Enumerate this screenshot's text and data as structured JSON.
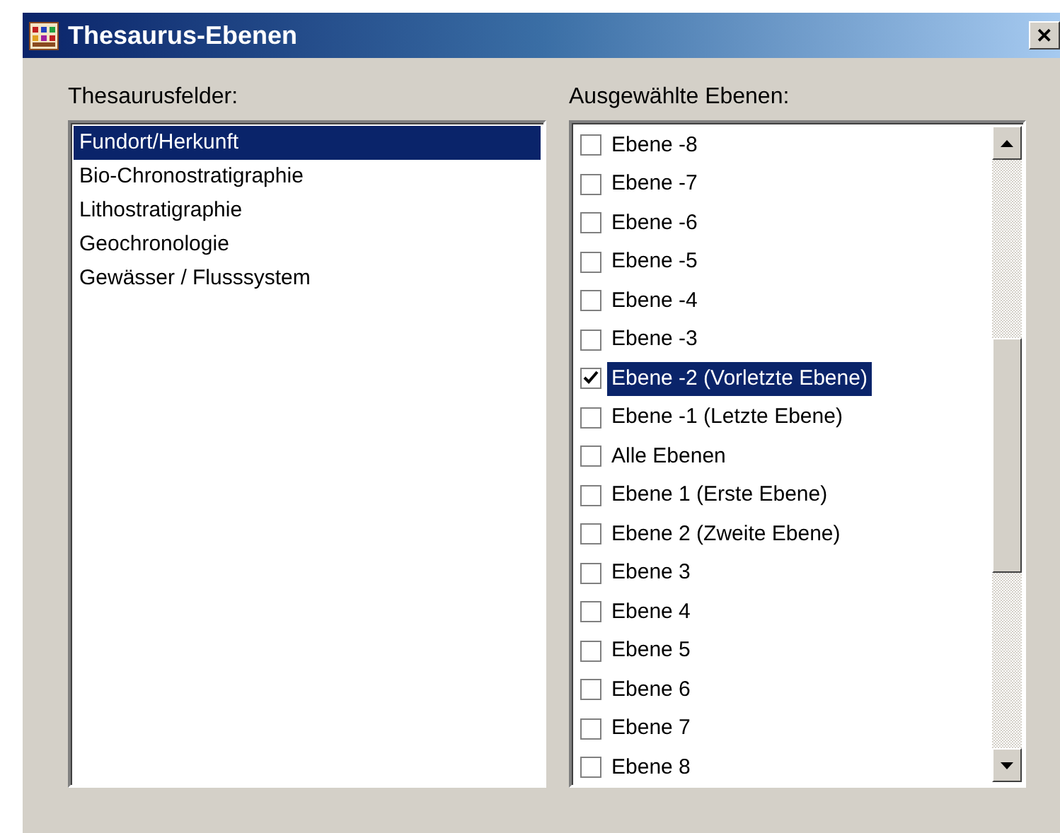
{
  "window": {
    "title": "Thesaurus-Ebenen",
    "close": "✕"
  },
  "left": {
    "label": "Thesaurusfelder:",
    "items": [
      {
        "text": "Fundort/Herkunft",
        "selected": true
      },
      {
        "text": "Bio-Chronostratigraphie",
        "selected": false
      },
      {
        "text": "Lithostratigraphie",
        "selected": false
      },
      {
        "text": "Geochronologie",
        "selected": false
      },
      {
        "text": "Gewässer / Flusssystem",
        "selected": false
      }
    ]
  },
  "right": {
    "label": "Ausgewählte Ebenen:",
    "items": [
      {
        "text": "Ebene -8",
        "checked": false,
        "selected": false
      },
      {
        "text": "Ebene -7",
        "checked": false,
        "selected": false
      },
      {
        "text": "Ebene -6",
        "checked": false,
        "selected": false
      },
      {
        "text": "Ebene -5",
        "checked": false,
        "selected": false
      },
      {
        "text": "Ebene -4",
        "checked": false,
        "selected": false
      },
      {
        "text": "Ebene -3",
        "checked": false,
        "selected": false
      },
      {
        "text": "Ebene -2 (Vorletzte Ebene)",
        "checked": true,
        "selected": true
      },
      {
        "text": "Ebene -1 (Letzte Ebene)",
        "checked": false,
        "selected": false
      },
      {
        "text": "Alle Ebenen",
        "checked": false,
        "selected": false
      },
      {
        "text": "Ebene 1 (Erste Ebene)",
        "checked": false,
        "selected": false
      },
      {
        "text": "Ebene 2 (Zweite Ebene)",
        "checked": false,
        "selected": false
      },
      {
        "text": "Ebene 3",
        "checked": false,
        "selected": false
      },
      {
        "text": "Ebene 4",
        "checked": false,
        "selected": false
      },
      {
        "text": "Ebene 5",
        "checked": false,
        "selected": false
      },
      {
        "text": "Ebene 6",
        "checked": false,
        "selected": false
      },
      {
        "text": "Ebene 7",
        "checked": false,
        "selected": false
      },
      {
        "text": "Ebene 8",
        "checked": false,
        "selected": false
      }
    ]
  }
}
